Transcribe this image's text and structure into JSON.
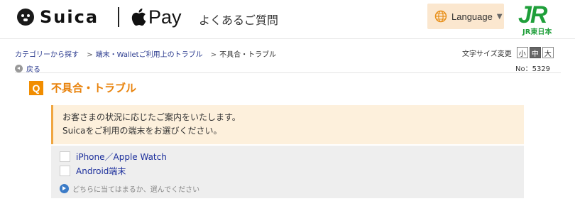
{
  "header": {
    "brand_text": "Suica",
    "pay_text": "Pay",
    "faq_title": "よくあるご質問",
    "language_label": "Language",
    "jr_mark": "JR",
    "jr_sub": "JR東日本",
    "accent_color": "#fbe7cf",
    "jr_color": "#1f9f3a"
  },
  "breadcrumb": {
    "items": [
      "カテゴリーから探す",
      "端末・Walletご利用上のトラブル",
      "不具合・トラブル"
    ],
    "separator": ">"
  },
  "font_size": {
    "label": "文字サイズ変更",
    "options": [
      "小",
      "中",
      "大"
    ],
    "selected": "中"
  },
  "back_label": "戻る",
  "doc_number": "No：5329",
  "question": {
    "badge": "Q",
    "title": "不具合・トラブル",
    "color": "#e8820b"
  },
  "message": {
    "line1": "お客さまの状況に応じたご案内をいたします。",
    "line2": "Suicaをご利用の端末をお選びください。"
  },
  "options": [
    "iPhone／Apple Watch",
    "Android端末"
  ],
  "hint": "どちらに当てはまるか、選んでください"
}
